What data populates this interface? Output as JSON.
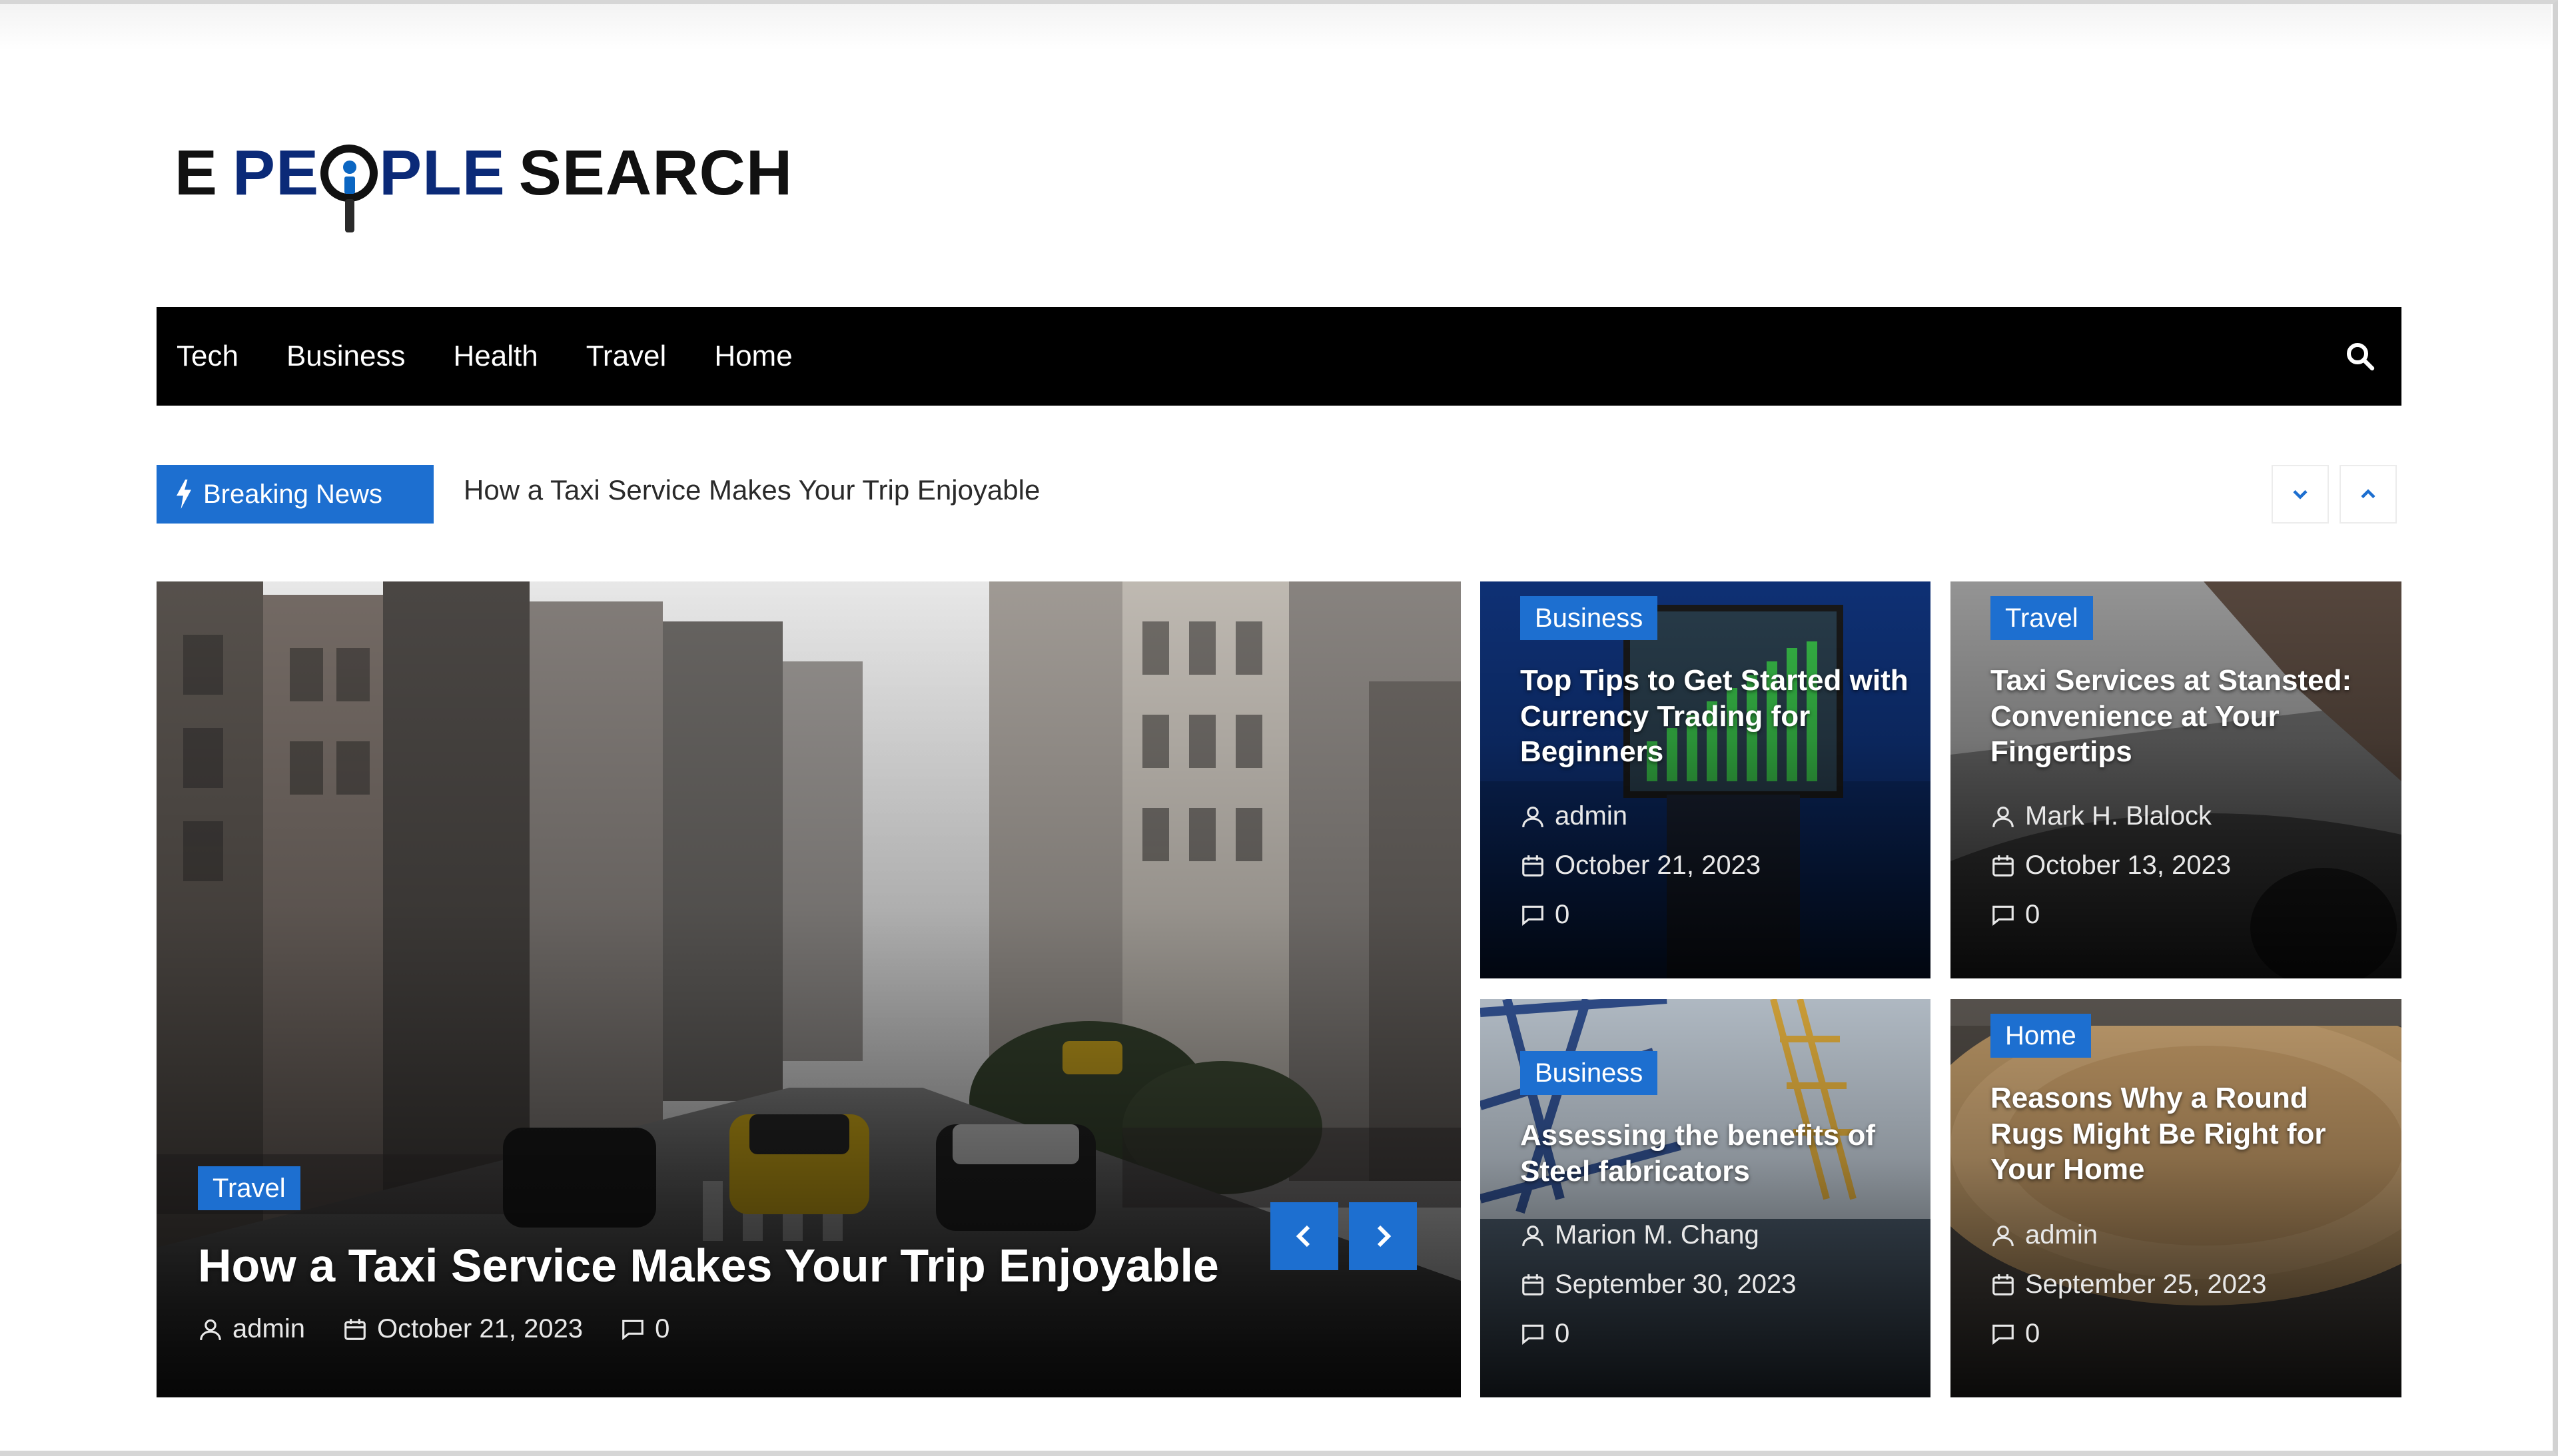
{
  "logo": {
    "part1": "E",
    "part2a": "PE",
    "part2b": "PLE",
    "part3": "SEARCH"
  },
  "nav": {
    "items": [
      "Tech",
      "Business",
      "Health",
      "Travel",
      "Home"
    ]
  },
  "breaking": {
    "label": "Breaking News",
    "headline": "How a Taxi Service Makes Your Trip Enjoyable"
  },
  "featured": {
    "category": "Travel",
    "title": "How a Taxi Service Makes Your Trip Enjoyable",
    "author": "admin",
    "date": "October 21, 2023",
    "comments": "0"
  },
  "cards": [
    {
      "category": "Business",
      "title": "Top Tips to Get Started with Currency Trading for Beginners",
      "author": "admin",
      "date": "October 21, 2023",
      "comments": "0"
    },
    {
      "category": "Travel",
      "title": "Taxi Services at Stansted: Convenience at Your Fingertips",
      "author": "Mark H. Blalock",
      "date": "October 13, 2023",
      "comments": "0"
    },
    {
      "category": "Business",
      "title": "Assessing the benefits of Steel fabricators",
      "author": "Marion M. Chang",
      "date": "September 30, 2023",
      "comments": "0"
    },
    {
      "category": "Home",
      "title": "Reasons Why a Round Rugs Might Be Right for Your Home",
      "author": "admin",
      "date": "September 25, 2023",
      "comments": "0"
    }
  ],
  "colors": {
    "accent": "#1d6fd0",
    "nav_bg": "#000000",
    "logo_blue": "#0b2a78"
  }
}
